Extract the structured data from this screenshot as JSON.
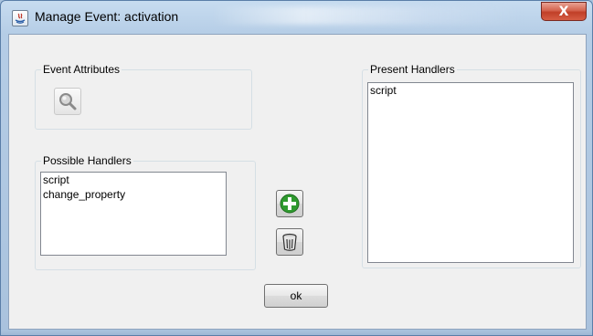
{
  "window": {
    "title": "Manage Event: activation",
    "close_glyph": "X"
  },
  "event_attributes": {
    "legend": "Event Attributes",
    "button_icon": "magnifier-icon"
  },
  "possible_handlers": {
    "legend": "Possible Handlers",
    "items": [
      "script",
      "change_property"
    ]
  },
  "present_handlers": {
    "legend": "Present Handlers",
    "items": [
      "script"
    ]
  },
  "actions": {
    "add_icon": "green-plus-icon",
    "remove_icon": "trash-can-icon",
    "ok_label": "ok"
  },
  "colors": {
    "title_bar": "#b5cde6",
    "close_button": "#c94a33",
    "add_icon_green": "#2f9a2f"
  }
}
